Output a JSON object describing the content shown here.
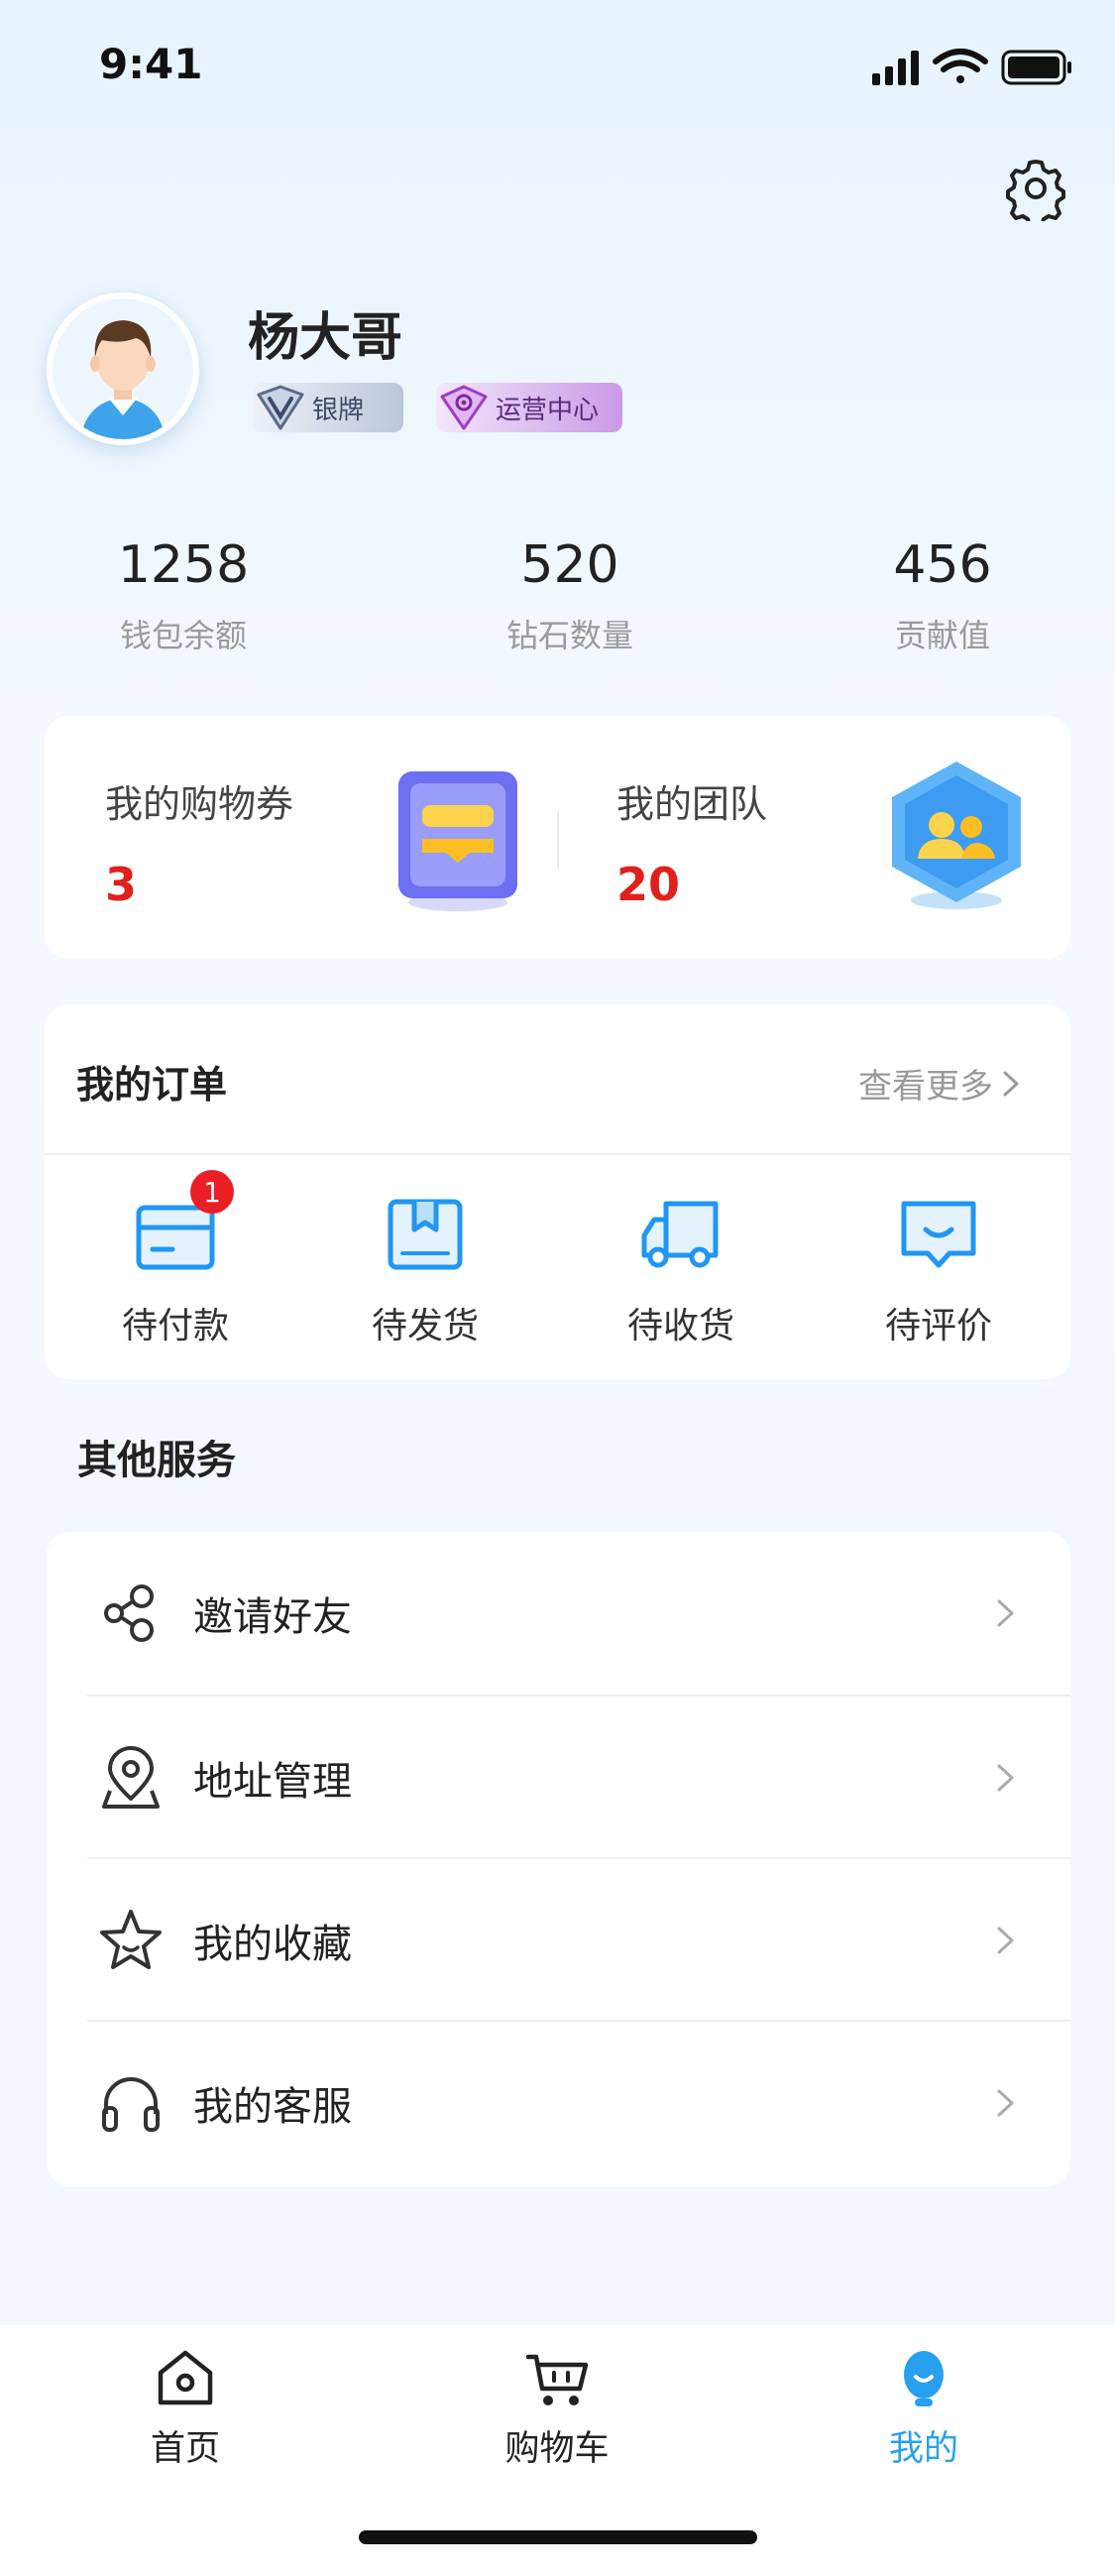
{
  "status_bar": {
    "time": "9:41"
  },
  "profile": {
    "name": "杨大哥",
    "badges": [
      {
        "label": "银牌",
        "icon": "silver-v-icon"
      },
      {
        "label": "运营中心",
        "icon": "ops-center-icon"
      }
    ]
  },
  "stats": [
    {
      "value": "1258",
      "label": "钱包余额"
    },
    {
      "value": "520",
      "label": "钻石数量"
    },
    {
      "value": "456",
      "label": "贡献值"
    }
  ],
  "assets": {
    "coupons": {
      "title": "我的购物券",
      "value": "3"
    },
    "team": {
      "title": "我的团队",
      "value": "20"
    }
  },
  "orders": {
    "title": "我的订单",
    "more_label": "查看更多",
    "items": [
      {
        "label": "待付款",
        "badge": "1",
        "icon": "wallet-card-icon"
      },
      {
        "label": "待发货",
        "icon": "package-icon"
      },
      {
        "label": "待收货",
        "icon": "truck-icon"
      },
      {
        "label": "待评价",
        "icon": "chat-review-icon"
      }
    ]
  },
  "services": {
    "title": "其他服务",
    "items": [
      {
        "label": "邀请好友",
        "icon": "share-icon"
      },
      {
        "label": "地址管理",
        "icon": "location-pin-icon"
      },
      {
        "label": "我的收藏",
        "icon": "star-icon"
      },
      {
        "label": "我的客服",
        "icon": "headphones-icon"
      }
    ]
  },
  "tabbar": {
    "items": [
      {
        "label": "首页",
        "icon": "home-icon"
      },
      {
        "label": "购物车",
        "icon": "cart-icon"
      },
      {
        "label": "我的",
        "icon": "profile-icon",
        "active": true
      }
    ]
  },
  "colors": {
    "accent": "#29a0ee",
    "badge_red": "#ea1f25",
    "value_red": "#e0201c"
  }
}
